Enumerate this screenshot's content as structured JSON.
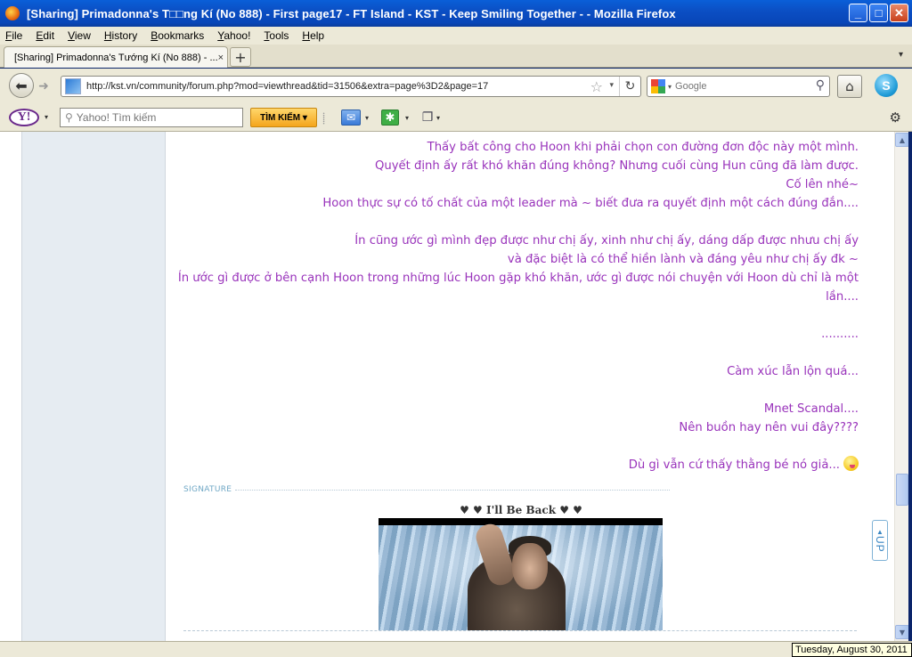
{
  "window": {
    "title": "[Sharing] Primadonna's T□□ng Kí (No 888) - First page17 - FT Island - KST - Keep Smiling Together - - Mozilla Firefox",
    "buttons": {
      "minimize": "_",
      "maximize": "□",
      "close": "✕"
    }
  },
  "menu": [
    "File",
    "Edit",
    "View",
    "History",
    "Bookmarks",
    "Yahoo!",
    "Tools",
    "Help"
  ],
  "tabs": [
    {
      "label": "[Sharing] Primadonna's Tướng Kí (No 888) - ...",
      "close": "×"
    }
  ],
  "newtab_label": "+",
  "nav": {
    "url": "http://kst.vn/community/forum.php?mod=viewthread&tid=31506&extra=page%3D2&page=17",
    "search_placeholder": "Google"
  },
  "yahoo": {
    "logo": "Y!",
    "search_placeholder": "Yahoo! Tìm kiếm",
    "search_button": "TÌM KIẾM ▾"
  },
  "post": {
    "lines": [
      "Thấy bất công cho Hoon khi phải chọn con đường đơn độc này một mình.",
      "Quyết định ấy rất khó khăn đúng không? Nhưng cuối cùng Hun cũng đã làm được.",
      "Cố lên nhé~",
      "Hoon thực sự có tố chất của một leader mà ~ biết đưa ra quyết định một cách đúng đắn....",
      "Ín cũng ước gì mình đẹp được như chị ấy, xinh như chị ấy, dáng dấp được nhưu chị ấy",
      "và đặc biệt là có thể hiền lành và đáng yêu như chị ấy đk ~",
      "Ín ước gì được ở bên cạnh Hoon trong những lúc Hoon gặp khó khăn, ước gì được nói chuyện với Hoon dù chỉ là một lần....",
      "..........",
      "Càm xúc lẫn lộn quá...",
      "Mnet Scandal....",
      "Nên buồn hay nên vui đây????",
      "Dù gì vẫn cứ thấy thằng bé nó giả..."
    ]
  },
  "signature": {
    "label": "SIGNATURE",
    "title": "♥ ♥ I'll Be Back ♥ ♥"
  },
  "up_button": "UP",
  "status": {
    "date_tooltip": "Tuesday, August 30, 2011"
  },
  "colors": {
    "post_text": "#9933bb",
    "title_bar": "#0a5fd8",
    "sidebar_bg": "#e6ecf2"
  }
}
